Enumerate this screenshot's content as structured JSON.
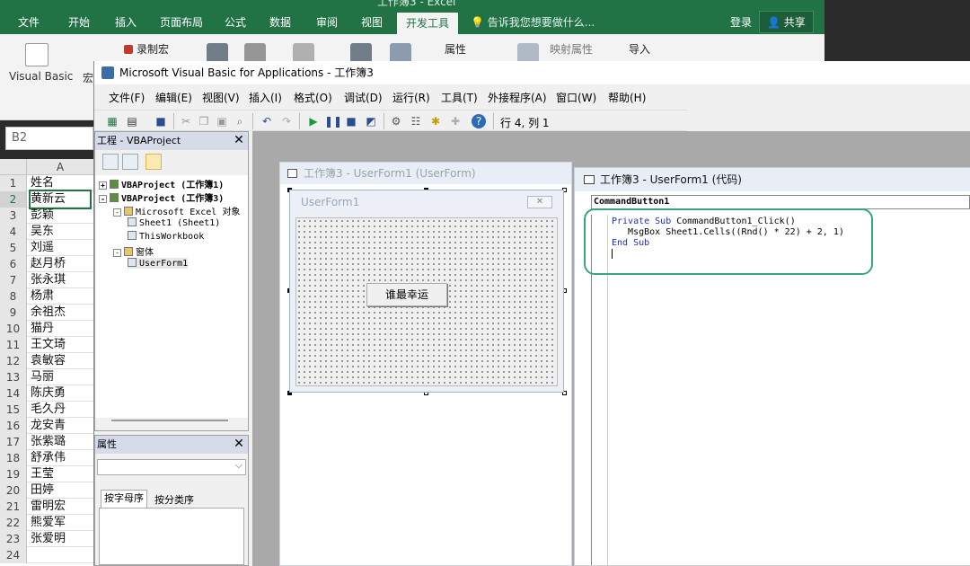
{
  "excel": {
    "title": "工作簿3 - Excel",
    "tabs": [
      "文件",
      "开始",
      "插入",
      "页面布局",
      "公式",
      "数据",
      "审阅",
      "视图",
      "开发工具"
    ],
    "active_tab": "开发工具",
    "search": "告诉我您想要做什么...",
    "login": "登录",
    "share": "共享",
    "ribbon": {
      "visual_basic": "Visual Basic",
      "macros": "宏",
      "record_macro": "录制宏",
      "properties": "属性",
      "map_properties": "映射属性",
      "import": "导入"
    },
    "namebox": "B2",
    "column_header": "A",
    "rows": [
      {
        "n": "1",
        "v": "姓名"
      },
      {
        "n": "2",
        "v": "黄新云"
      },
      {
        "n": "3",
        "v": "彭颖"
      },
      {
        "n": "4",
        "v": "吴东"
      },
      {
        "n": "5",
        "v": "刘遥"
      },
      {
        "n": "6",
        "v": "赵月桥"
      },
      {
        "n": "7",
        "v": "张永琪"
      },
      {
        "n": "8",
        "v": "杨肃"
      },
      {
        "n": "9",
        "v": "余祖杰"
      },
      {
        "n": "10",
        "v": "猫丹"
      },
      {
        "n": "11",
        "v": "王文琦"
      },
      {
        "n": "12",
        "v": "袁敏容"
      },
      {
        "n": "13",
        "v": "马丽"
      },
      {
        "n": "14",
        "v": "陈庆勇"
      },
      {
        "n": "15",
        "v": "毛久丹"
      },
      {
        "n": "16",
        "v": "龙安青"
      },
      {
        "n": "17",
        "v": "张紫璐"
      },
      {
        "n": "18",
        "v": "舒承伟"
      },
      {
        "n": "19",
        "v": "王莹"
      },
      {
        "n": "20",
        "v": "田婷"
      },
      {
        "n": "21",
        "v": "雷明宏"
      },
      {
        "n": "22",
        "v": "熊爱军"
      },
      {
        "n": "23",
        "v": "张爱明"
      },
      {
        "n": "24",
        "v": ""
      }
    ]
  },
  "vbe": {
    "title": "Microsoft Visual Basic for Applications - 工作簿3",
    "menus": [
      "文件(F)",
      "编辑(E)",
      "视图(V)",
      "插入(I)",
      "格式(O)",
      "调试(D)",
      "运行(R)",
      "工具(T)",
      "外接程序(A)",
      "窗口(W)",
      "帮助(H)"
    ],
    "cursor_pos": "行 4, 列 1",
    "project": {
      "title": "工程 - VBAProject",
      "nodes": [
        {
          "text": "VBAProject (工作簿1)",
          "level": 0,
          "bold": true,
          "exp": "+"
        },
        {
          "text": "VBAProject (工作簿3)",
          "level": 0,
          "bold": true,
          "exp": "-"
        },
        {
          "text": "Microsoft Excel 对象",
          "level": 1,
          "bold": false,
          "exp": "-"
        },
        {
          "text": "Sheet1 (Sheet1)",
          "level": 2,
          "bold": false,
          "exp": ""
        },
        {
          "text": "ThisWorkbook",
          "level": 2,
          "bold": false,
          "exp": ""
        },
        {
          "text": "窗体",
          "level": 1,
          "bold": false,
          "exp": "-"
        },
        {
          "text": "UserForm1",
          "level": 2,
          "bold": false,
          "exp": "",
          "selected": true
        }
      ]
    },
    "properties": {
      "title": "属性",
      "tab_alpha": "按字母序",
      "tab_category": "按分类序"
    },
    "designer": {
      "title": "工作簿3 - UserForm1 (UserForm)",
      "form_caption": "UserForm1",
      "button_label": "谁最幸运"
    },
    "code": {
      "title": "工作簿3 - UserForm1 (代码)",
      "object_combo": "CommandButton1",
      "lines": [
        "Private Sub CommandButton1_Click()",
        "   MsgBox Sheet1.Cells((Rnd() * 22) + 2, 1)",
        "End Sub"
      ]
    }
  },
  "colors": {
    "excel_green": "#217346",
    "keyword_blue": "#1f2fb5",
    "annotation_green": "#3aa57c"
  }
}
